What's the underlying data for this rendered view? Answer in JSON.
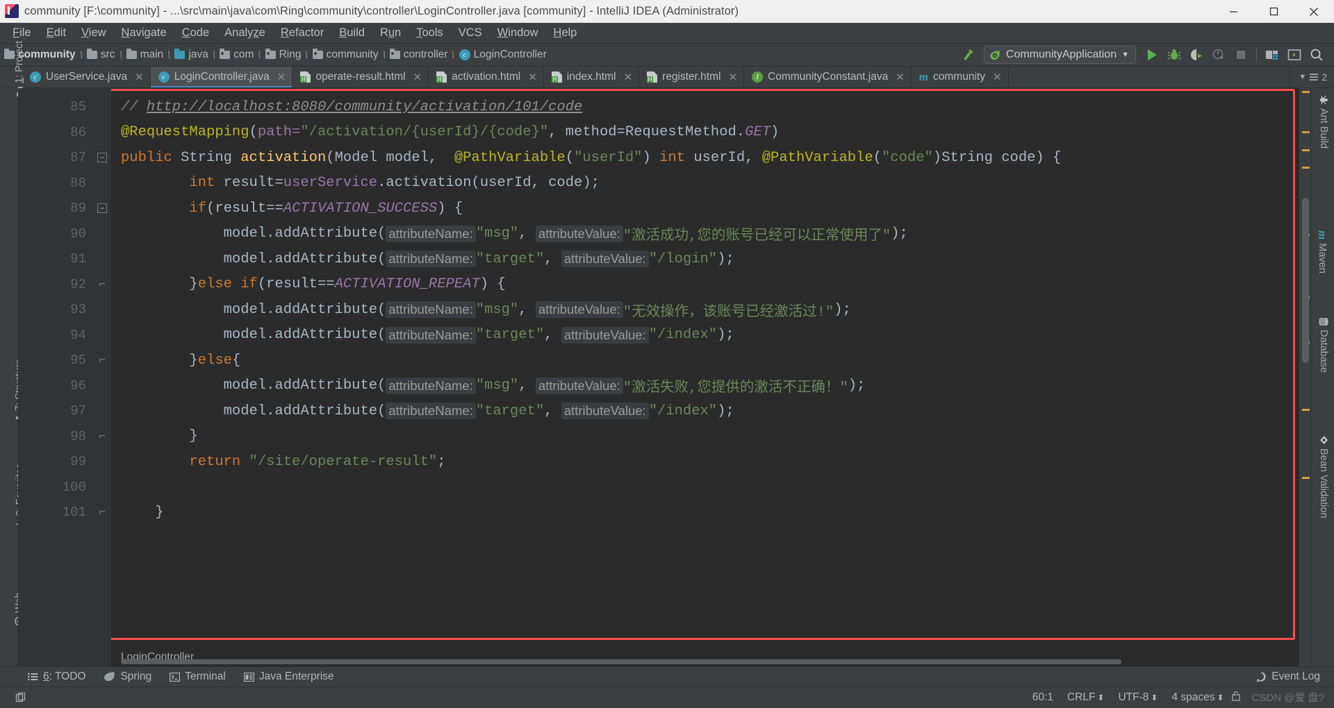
{
  "window": {
    "title": "community [F:\\community] - ...\\src\\main\\java\\com\\Ring\\community\\controller\\LoginController.java [community] - IntelliJ IDEA (Administrator)",
    "app_icon": "intellij-idea-icon",
    "minimize_label": "—",
    "maximize_label": "▢",
    "close_label": "✕"
  },
  "menu": {
    "items": [
      {
        "pre": "",
        "mn": "F",
        "post": "ile"
      },
      {
        "pre": "",
        "mn": "E",
        "post": "dit"
      },
      {
        "pre": "",
        "mn": "V",
        "post": "iew"
      },
      {
        "pre": "",
        "mn": "N",
        "post": "avigate"
      },
      {
        "pre": "",
        "mn": "C",
        "post": "ode"
      },
      {
        "pre": "Analy",
        "mn": "z",
        "post": "e"
      },
      {
        "pre": "",
        "mn": "R",
        "post": "efactor"
      },
      {
        "pre": "",
        "mn": "B",
        "post": "uild"
      },
      {
        "pre": "R",
        "mn": "u",
        "post": "n"
      },
      {
        "pre": "",
        "mn": "T",
        "post": "ools"
      },
      {
        "pre": "VCS",
        "mn": "",
        "post": ""
      },
      {
        "pre": "",
        "mn": "W",
        "post": "indow"
      },
      {
        "pre": "",
        "mn": "H",
        "post": "elp"
      }
    ]
  },
  "breadcrumb": {
    "separator": "\\",
    "items": [
      {
        "label": "community",
        "icon": "folder-icon",
        "bold": true
      },
      {
        "label": "src",
        "icon": "folder-icon",
        "bold": false
      },
      {
        "label": "main",
        "icon": "folder-icon",
        "bold": false
      },
      {
        "label": "java",
        "icon": "source-folder-icon",
        "bold": false
      },
      {
        "label": "com",
        "icon": "package-folder-icon",
        "bold": false
      },
      {
        "label": "Ring",
        "icon": "package-folder-icon",
        "bold": false
      },
      {
        "label": "community",
        "icon": "package-folder-icon",
        "bold": false
      },
      {
        "label": "controller",
        "icon": "package-folder-icon",
        "bold": false
      },
      {
        "label": "LoginController",
        "icon": "java-class-icon",
        "bold": false
      }
    ]
  },
  "toolbar": {
    "run_config": "CommunityApplication",
    "run_config_icon": "spring-boot-icon",
    "dropdown_arrow": "▼",
    "buttons": [
      {
        "name": "build-project-button",
        "icon": "hammer-icon"
      },
      {
        "name": "run-button",
        "icon": "play-icon"
      },
      {
        "name": "debug-button",
        "icon": "bug-icon"
      },
      {
        "name": "run-with-coverage-button",
        "icon": "coverage-icon"
      },
      {
        "name": "profile-button",
        "icon": "profiler-icon"
      },
      {
        "name": "stop-button",
        "icon": "stop-icon"
      },
      {
        "name": "project-structure-button",
        "icon": "project-structure-icon"
      },
      {
        "name": "terminal-toggle-button",
        "icon": "terminal-icon"
      },
      {
        "name": "search-everywhere-button",
        "icon": "search-icon"
      }
    ]
  },
  "tabs": {
    "overflow_count": "2",
    "overflow_arrow": "▼",
    "close_glyph": "✕",
    "items": [
      {
        "label": "UserService.java",
        "icon": "java-class-icon",
        "active": false
      },
      {
        "label": "LoginController.java",
        "icon": "java-class-icon",
        "active": true
      },
      {
        "label": "operate-result.html",
        "icon": "html-file-icon",
        "active": false
      },
      {
        "label": "activation.html",
        "icon": "html-file-icon",
        "active": false
      },
      {
        "label": "index.html",
        "icon": "html-file-icon",
        "active": false
      },
      {
        "label": "register.html",
        "icon": "html-file-icon",
        "active": false
      },
      {
        "label": "CommunityConstant.java",
        "icon": "java-interface-icon",
        "active": false
      },
      {
        "label": "community",
        "icon": "maven-icon",
        "active": false
      }
    ]
  },
  "left_tool_strip": {
    "items": [
      {
        "label_pre": "",
        "label_u": "1",
        "label_post": ": Project",
        "icon": "project-folder-icon"
      },
      {
        "label_pre": "",
        "label_u": "7",
        "label_post": ": Structure",
        "icon": "structure-icon"
      },
      {
        "label_pre": "",
        "label_u": "2",
        "label_post": ": Favorites",
        "icon": "star-icon"
      },
      {
        "label_pre": "Web",
        "label_u": "",
        "label_post": "",
        "icon": "web-icon"
      }
    ]
  },
  "right_tool_strip": {
    "items": [
      {
        "label": "Ant Build",
        "icon": "ant-icon"
      },
      {
        "label": "Maven",
        "icon": "maven-icon"
      },
      {
        "label": "Database",
        "icon": "database-icon"
      },
      {
        "label": "Bean Validation",
        "icon": "bean-validation-icon"
      }
    ]
  },
  "editor": {
    "breadcrumb_bottom": "LoginController",
    "line_numbers": [
      "85",
      "86",
      "87",
      "88",
      "89",
      "90",
      "91",
      "92",
      "93",
      "94",
      "95",
      "96",
      "97",
      "98",
      "99",
      "100",
      "101"
    ],
    "fold_markers": [
      "",
      "",
      "minus",
      "",
      "minus",
      "",
      "",
      "brace",
      "",
      "",
      "brace",
      "",
      "",
      "brace",
      "",
      "",
      "brace"
    ],
    "code_lines": [
      {
        "n": "85",
        "tokens": [
          {
            "t": "// ",
            "c": "t-cmt"
          },
          {
            "t": "http://localhost:8080/community/activation/101/code",
            "c": "t-link"
          }
        ]
      },
      {
        "n": "86",
        "tokens": [
          {
            "t": "@RequestMapping",
            "c": "t-ann"
          },
          {
            "t": "(",
            "c": "t-def"
          },
          {
            "t": "path=",
            "c": "t-fld"
          },
          {
            "t": "\"/activation/{userId}/{code}\"",
            "c": "t-str"
          },
          {
            "t": ", ",
            "c": "t-def"
          },
          {
            "t": "method=RequestMethod.",
            "c": "t-def"
          },
          {
            "t": "GET",
            "c": "t-stc"
          },
          {
            "t": ")",
            "c": "t-def"
          }
        ]
      },
      {
        "n": "87",
        "tokens": [
          {
            "t": "public ",
            "c": "t-kw"
          },
          {
            "t": "String ",
            "c": "t-def"
          },
          {
            "t": "activation",
            "c": "t-mth"
          },
          {
            "t": "(Model model,  ",
            "c": "t-def"
          },
          {
            "t": "@PathVariable",
            "c": "t-ann"
          },
          {
            "t": "(",
            "c": "t-def"
          },
          {
            "t": "\"userId\"",
            "c": "t-str"
          },
          {
            "t": ") ",
            "c": "t-def"
          },
          {
            "t": "int ",
            "c": "t-kw"
          },
          {
            "t": "userId, ",
            "c": "t-def"
          },
          {
            "t": "@PathVariable",
            "c": "t-ann"
          },
          {
            "t": "(",
            "c": "t-def"
          },
          {
            "t": "\"code\"",
            "c": "t-str"
          },
          {
            "t": ")String code) {",
            "c": "t-def"
          }
        ]
      },
      {
        "n": "88",
        "indent": 2,
        "tokens": [
          {
            "t": "int ",
            "c": "t-kw"
          },
          {
            "t": "result=",
            "c": "t-def"
          },
          {
            "t": "userService",
            "c": "t-fld"
          },
          {
            "t": ".activation(userId, code);",
            "c": "t-def"
          }
        ]
      },
      {
        "n": "89",
        "indent": 2,
        "tokens": [
          {
            "t": "if",
            "c": "t-kw"
          },
          {
            "t": "(result==",
            "c": "t-def"
          },
          {
            "t": "ACTIVATION_SUCCESS",
            "c": "t-stc"
          },
          {
            "t": ") {",
            "c": "t-def"
          }
        ]
      },
      {
        "n": "90",
        "indent": 3,
        "tokens": [
          {
            "t": "model.addAttribute(",
            "c": "t-def"
          },
          {
            "t": "attributeName:",
            "c": "hint"
          },
          {
            "t": "\"msg\"",
            "c": "t-str"
          },
          {
            "t": ", ",
            "c": "t-def"
          },
          {
            "t": "attributeValue:",
            "c": "hint"
          },
          {
            "t": "\"激活成功,您的账号已经可以正常使用了\"",
            "c": "t-str"
          },
          {
            "t": ");",
            "c": "t-def"
          }
        ]
      },
      {
        "n": "91",
        "indent": 3,
        "tokens": [
          {
            "t": "model.addAttribute(",
            "c": "t-def"
          },
          {
            "t": "attributeName:",
            "c": "hint"
          },
          {
            "t": "\"target\"",
            "c": "t-str"
          },
          {
            "t": ", ",
            "c": "t-def"
          },
          {
            "t": "attributeValue:",
            "c": "hint"
          },
          {
            "t": "\"/login\"",
            "c": "t-str"
          },
          {
            "t": ");",
            "c": "t-def"
          }
        ]
      },
      {
        "n": "92",
        "indent": 2,
        "tokens": [
          {
            "t": "}",
            "c": "t-def"
          },
          {
            "t": "else if",
            "c": "t-kw"
          },
          {
            "t": "(result==",
            "c": "t-def"
          },
          {
            "t": "ACTIVATION_REPEAT",
            "c": "t-stc"
          },
          {
            "t": ") {",
            "c": "t-def"
          }
        ]
      },
      {
        "n": "93",
        "indent": 3,
        "tokens": [
          {
            "t": "model.addAttribute(",
            "c": "t-def"
          },
          {
            "t": "attributeName:",
            "c": "hint"
          },
          {
            "t": "\"msg\"",
            "c": "t-str"
          },
          {
            "t": ", ",
            "c": "t-def"
          },
          {
            "t": "attributeValue:",
            "c": "hint"
          },
          {
            "t": "\"无效操作，该账号已经激活过!\"",
            "c": "t-str"
          },
          {
            "t": ");",
            "c": "t-def"
          }
        ]
      },
      {
        "n": "94",
        "indent": 3,
        "tokens": [
          {
            "t": "model.addAttribute(",
            "c": "t-def"
          },
          {
            "t": "attributeName:",
            "c": "hint"
          },
          {
            "t": "\"target\"",
            "c": "t-str"
          },
          {
            "t": ", ",
            "c": "t-def"
          },
          {
            "t": "attributeValue:",
            "c": "hint"
          },
          {
            "t": "\"/index\"",
            "c": "t-str"
          },
          {
            "t": ");",
            "c": "t-def"
          }
        ]
      },
      {
        "n": "95",
        "indent": 2,
        "tokens": [
          {
            "t": "}",
            "c": "t-def"
          },
          {
            "t": "else",
            "c": "t-kw"
          },
          {
            "t": "{",
            "c": "t-def"
          }
        ]
      },
      {
        "n": "96",
        "indent": 3,
        "tokens": [
          {
            "t": "model.addAttribute(",
            "c": "t-def"
          },
          {
            "t": "attributeName:",
            "c": "hint"
          },
          {
            "t": "\"msg\"",
            "c": "t-str"
          },
          {
            "t": ", ",
            "c": "t-def"
          },
          {
            "t": "attributeValue:",
            "c": "hint"
          },
          {
            "t": "\"激活失败,您提供的激活不正确！\"",
            "c": "t-str"
          },
          {
            "t": ");",
            "c": "t-def"
          }
        ]
      },
      {
        "n": "97",
        "indent": 3,
        "tokens": [
          {
            "t": "model.addAttribute(",
            "c": "t-def"
          },
          {
            "t": "attributeName:",
            "c": "hint"
          },
          {
            "t": "\"target\"",
            "c": "t-str"
          },
          {
            "t": ", ",
            "c": "t-def"
          },
          {
            "t": "attributeValue:",
            "c": "hint"
          },
          {
            "t": "\"/index\"",
            "c": "t-str"
          },
          {
            "t": ");",
            "c": "t-def"
          }
        ]
      },
      {
        "n": "98",
        "indent": 2,
        "tokens": [
          {
            "t": "}",
            "c": "t-def"
          }
        ]
      },
      {
        "n": "99",
        "indent": 2,
        "tokens": [
          {
            "t": "return ",
            "c": "t-kw"
          },
          {
            "t": "\"/site/operate-result\"",
            "c": "t-str"
          },
          {
            "t": ";",
            "c": "t-def"
          }
        ]
      },
      {
        "n": "100",
        "indent": 0,
        "tokens": []
      },
      {
        "n": "101",
        "indent": 1,
        "tokens": [
          {
            "t": "}",
            "c": "t-def"
          }
        ]
      }
    ]
  },
  "bottom_tools": {
    "items": [
      {
        "pre": "",
        "u": "6",
        "post": ": TODO",
        "icon": "todo-list-icon"
      },
      {
        "pre": "Spring",
        "u": "",
        "post": "",
        "icon": "spring-leaf-icon"
      },
      {
        "pre": "Terminal",
        "u": "",
        "post": "",
        "icon": "terminal-icon"
      },
      {
        "pre": "Java Enterprise",
        "u": "",
        "post": "",
        "icon": "java-enterprise-icon"
      }
    ],
    "event_log": "Event Log",
    "event_log_icon": "event-log-icon"
  },
  "statusbar": {
    "toggle_icon": "toggle-toolbar-icon",
    "caret_position": "60:1",
    "line_separator": "CRLF",
    "encoding": "UTF-8",
    "indent": "4 spaces",
    "lock_icon": "unlocked-icon",
    "watermark": "CSDN @爱 盘?"
  },
  "colors": {
    "titlebar_bg": "#f0f0f0",
    "chrome_bg": "#3c3f41",
    "editor_bg": "#2b2b2b",
    "gutter_bg": "#313335",
    "accent_blue": "#4a88c7",
    "highlight_red": "#ff4d4d",
    "string_green": "#6a8759",
    "keyword_orange": "#cc7832",
    "annotation_yellow": "#bbb529",
    "static_purple": "#9876aa",
    "method_gold": "#ffc66d"
  }
}
